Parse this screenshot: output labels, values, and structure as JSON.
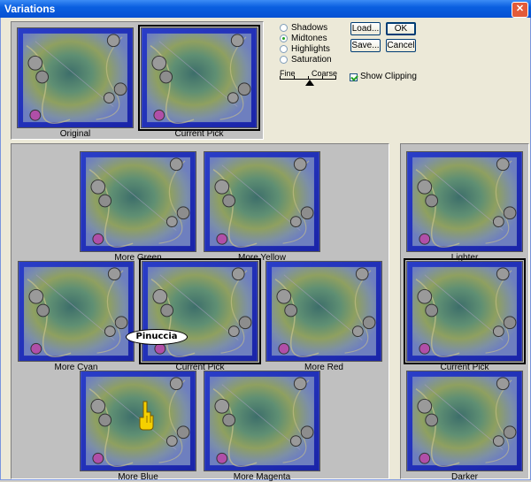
{
  "window": {
    "title": "Variations",
    "close_glyph": "✕"
  },
  "original_label": "Original",
  "current_pick_label": "Current Pick",
  "tone_options": [
    {
      "label": "Shadows",
      "checked": false
    },
    {
      "label": "Midtones",
      "checked": true
    },
    {
      "label": "Highlights",
      "checked": false
    },
    {
      "label": "Saturation",
      "checked": false
    }
  ],
  "buttons": {
    "load": "Load...",
    "ok": "OK",
    "save": "Save...",
    "cancel": "Cancel"
  },
  "slider": {
    "fine": "Fine",
    "coarse": "Coarse",
    "level": 0.5
  },
  "show_clipping": {
    "label": "Show Clipping",
    "checked": true
  },
  "grid_labels": {
    "more_green": "More Green",
    "more_yellow": "More Yellow",
    "more_cyan": "More Cyan",
    "current_pick": "Current Pick",
    "more_red": "More Red",
    "more_blue": "More Blue",
    "more_magenta": "More Magenta"
  },
  "side_labels": {
    "lighter": "Lighter",
    "current_pick": "Current Pick",
    "darker": "Darker"
  },
  "overlay_text": "Pinuccia",
  "icons": {
    "cursor": "pointing-hand-icon"
  }
}
